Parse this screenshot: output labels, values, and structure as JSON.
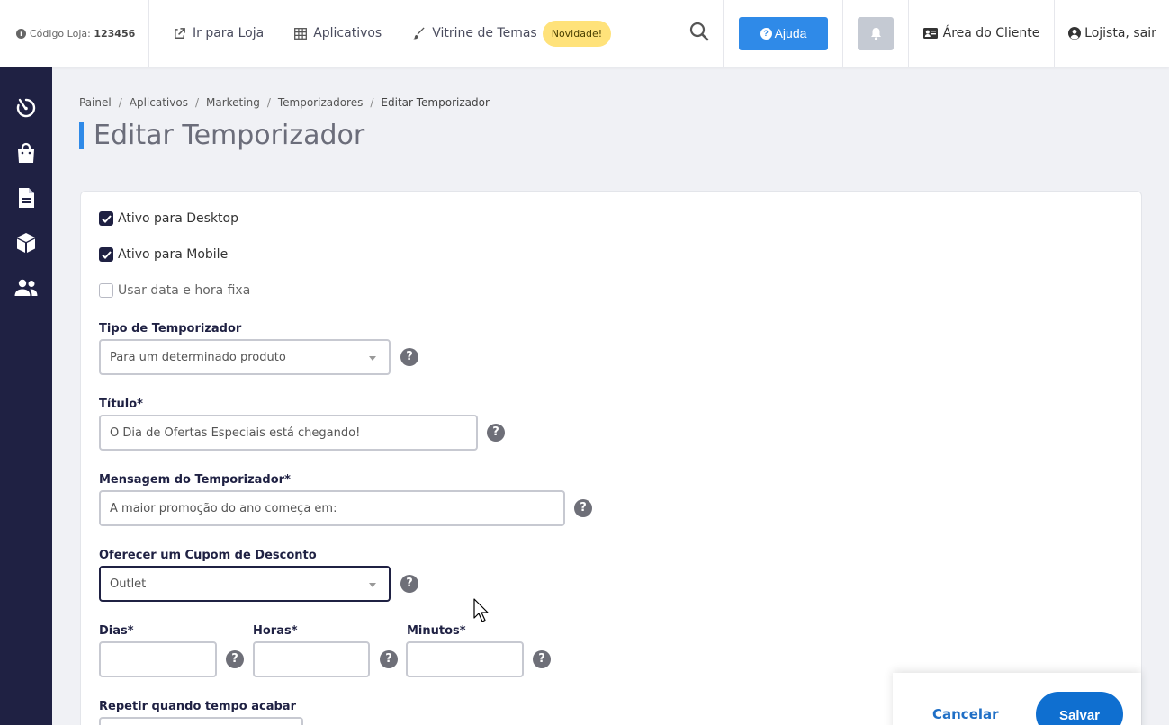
{
  "topbar": {
    "store_code_label": "Código Loja:",
    "store_code_value": "123456",
    "nav": [
      {
        "label": "Ir para Loja",
        "icon": "external-link-icon"
      },
      {
        "label": "Aplicativos",
        "icon": "grid-icon"
      },
      {
        "label": "Vitrine de Temas",
        "icon": "brush-icon"
      }
    ],
    "badge": "Novidade!",
    "help_label": "Ajuda",
    "client_area_label": "Área do Cliente",
    "logout_label": "Lojista, sair"
  },
  "sidebar": {
    "items": [
      {
        "icon": "dashboard-icon"
      },
      {
        "icon": "shopping-bag-icon"
      },
      {
        "icon": "document-icon"
      },
      {
        "icon": "box-icon"
      },
      {
        "icon": "users-icon"
      }
    ]
  },
  "breadcrumb": [
    "Painel",
    "Aplicativos",
    "Marketing",
    "Temporizadores",
    "Editar Temporizador"
  ],
  "page": {
    "title": "Editar Temporizador"
  },
  "form": {
    "active_desktop": {
      "label": "Ativo para Desktop",
      "checked": true
    },
    "active_mobile": {
      "label": "Ativo para Mobile",
      "checked": true
    },
    "fixed_datetime": {
      "label": "Usar data e hora fixa",
      "checked": false
    },
    "timer_type": {
      "label": "Tipo de Temporizador",
      "value": "Para um determinado produto"
    },
    "title": {
      "label": "Título*",
      "value": "O Dia de Ofertas Especiais está chegando!"
    },
    "message": {
      "label": "Mensagem do Temporizador*",
      "value": "A maior promoção do ano começa em:"
    },
    "coupon": {
      "label": "Oferecer um Cupom de Desconto",
      "value": "Outlet"
    },
    "days": {
      "label": "Dias*",
      "value": ""
    },
    "hours": {
      "label": "Horas*",
      "value": ""
    },
    "minutes": {
      "label": "Minutos*",
      "value": ""
    },
    "repeat": {
      "label": "Repetir quando tempo acabar"
    },
    "help_glyph": "?"
  },
  "actions": {
    "cancel": "Cancelar",
    "save": "Salvar"
  },
  "colors": {
    "accent": "#2f8ae8",
    "sidebar": "#1f2143",
    "badge": "#ffe27a",
    "save": "#0f6fd0"
  }
}
